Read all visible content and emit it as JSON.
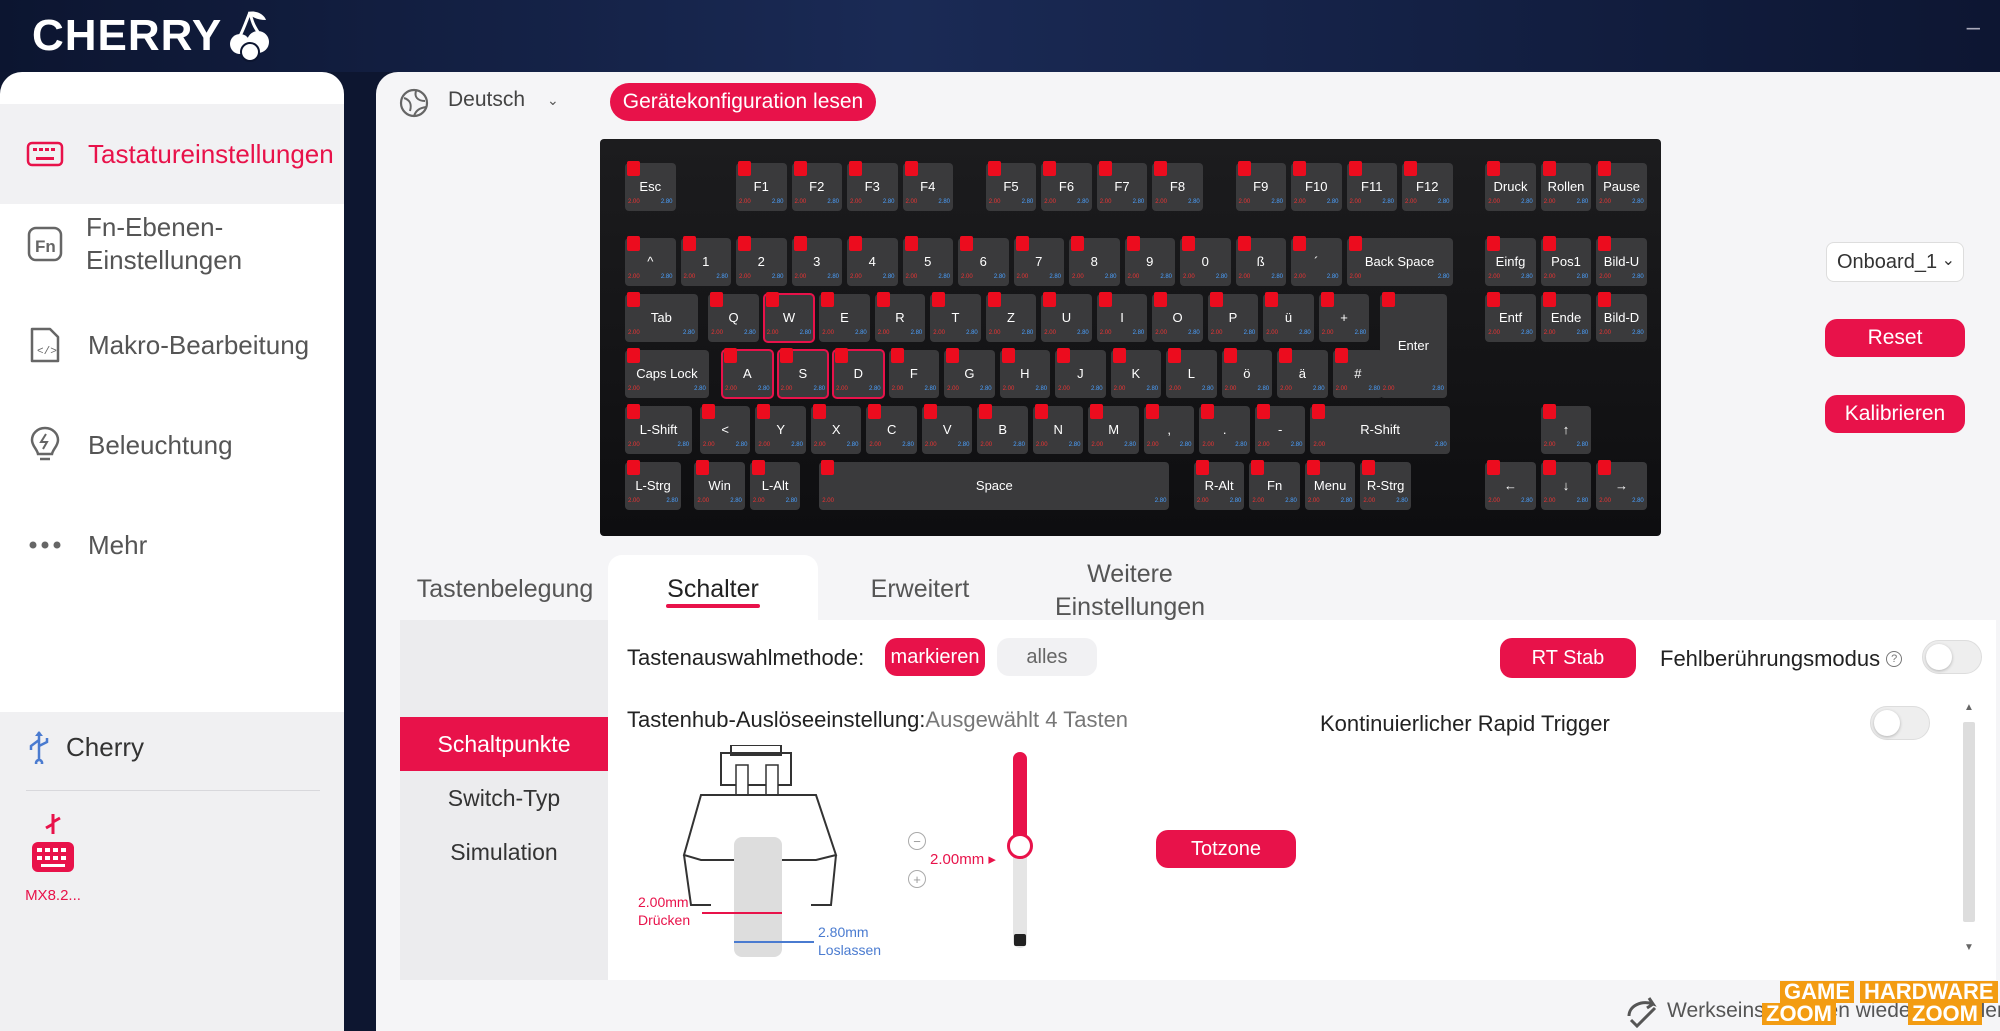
{
  "app": {
    "brand": "CHERRY",
    "minimize": "–"
  },
  "sidebar": {
    "items": [
      {
        "label": "Tastatureinstellungen",
        "icon": "keyboard-icon"
      },
      {
        "label": "Fn-Ebenen-\nEinstellungen",
        "icon": "fn-icon"
      },
      {
        "label": "Makro-Bearbeitung",
        "icon": "macro-file-icon"
      },
      {
        "label": "Beleuchtung",
        "icon": "lightbulb-icon"
      },
      {
        "label": "Mehr",
        "icon": "more-dots-icon"
      }
    ],
    "device_group": "Cherry",
    "device_name": "MX8.2..."
  },
  "header": {
    "language": "Deutsch",
    "read_config": "Gerätekonfiguration lesen"
  },
  "right_controls": {
    "profile": "Onboard_1",
    "reset": "Reset",
    "calibrate": "Kalibrieren"
  },
  "keyboard": {
    "press_value": "2.00",
    "release_value": "2.80",
    "rows": [
      [
        "Esc",
        "F1",
        "F2",
        "F3",
        "F4",
        "F5",
        "F6",
        "F7",
        "F8",
        "F9",
        "F10",
        "F11",
        "F12",
        "Druck",
        "Rollen",
        "Pause"
      ],
      [
        "^",
        "1",
        "2",
        "3",
        "4",
        "5",
        "6",
        "7",
        "8",
        "9",
        "0",
        "ß",
        "´",
        "Back Space",
        "Einfg",
        "Pos1",
        "Bild-U"
      ],
      [
        "Tab",
        "Q",
        "W",
        "E",
        "R",
        "T",
        "Z",
        "U",
        "I",
        "O",
        "P",
        "ü",
        "+",
        "Enter",
        "Entf",
        "Ende",
        "Bild-D"
      ],
      [
        "Caps Lock",
        "A",
        "S",
        "D",
        "F",
        "G",
        "H",
        "J",
        "K",
        "L",
        "ö",
        "ä",
        "#"
      ],
      [
        "L-Shift",
        "<",
        "Y",
        "X",
        "C",
        "V",
        "B",
        "N",
        "M",
        ",",
        ".",
        "-",
        "R-Shift",
        "↑"
      ],
      [
        "L-Strg",
        "Win",
        "L-Alt",
        "Space",
        "R-Alt",
        "Fn",
        "Menu",
        "R-Strg",
        "←",
        "↓",
        "→"
      ]
    ]
  },
  "tabs": {
    "items": [
      "Tastenbelegung",
      "Schalter",
      "Erweitert",
      "Weitere\nEinstellungen"
    ],
    "active": "Schalter"
  },
  "subnav": {
    "items": [
      "Schaltpunkte",
      "Switch-Typ",
      "Simulation"
    ],
    "active": "Schaltpunkte"
  },
  "switch_panel": {
    "selection_method_label": "Tastenauswahlmethode:",
    "mark_btn": "markieren",
    "all_btn": "alles",
    "rt_btn": "RT Stab",
    "misclick_label": "Fehlberührungsmodus",
    "misclick_help": "?",
    "stroke_label": "Tastenhub-Auslöseeinstellung:",
    "selected_text": "Ausgewählt 4 Tasten",
    "continuous_rt_label": "Kontinuierlicher Rapid Trigger",
    "press_value": "2.00mm",
    "press_label": "Drücken",
    "release_value": "2.80mm",
    "release_label": "Loslassen",
    "slider_value": "2.00mm",
    "slider_level": 0.48,
    "deadzone_btn": "Totzone",
    "minus": "−",
    "plus": "+"
  },
  "footer": {
    "reset_factory": "Werkseinstellungen wiederherstellen"
  },
  "watermark": {
    "line1a": "GAME",
    "line1b": "HARDWARE",
    "line2a": "ZOOM",
    "line2b": "ZOOM"
  }
}
